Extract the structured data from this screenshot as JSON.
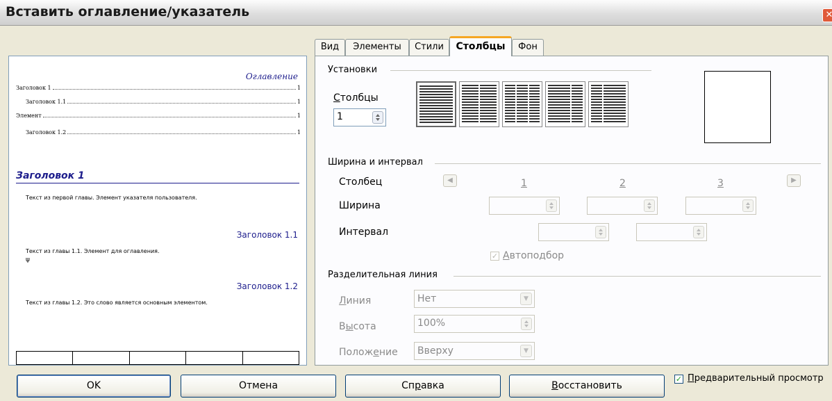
{
  "window": {
    "title": "Вставить оглавление/указатель",
    "close_symbol": "✕"
  },
  "tabs": [
    {
      "label": "Вид"
    },
    {
      "label": "Элементы"
    },
    {
      "label": "Стили"
    },
    {
      "label": "Столбцы",
      "active": true
    },
    {
      "label": "Фон"
    }
  ],
  "preview": {
    "toc_title": "Оглавление",
    "toc_entries": [
      {
        "text": "Заголовок 1",
        "page": "1"
      },
      {
        "text": "Заголовок 1.1",
        "page": "1"
      },
      {
        "text": "Элемент",
        "page": "1"
      },
      {
        "text": "Заголовок 1.2",
        "page": "1"
      }
    ],
    "heading1": "Заголовок 1",
    "text1": "Текст из первой главы. Элемент указателя пользователя.",
    "heading11": "Заголовок 1.1",
    "text11": "Текст из главы 1.1. Элемент для оглавления.",
    "marker": "ψ",
    "heading12": "Заголовок 1.2",
    "text12": "Текст из главы 1.2. Это слово является основным элементом."
  },
  "settings": {
    "section_label": "Установки",
    "columns_label_mnemonic": "С",
    "columns_label_rest": "толбцы",
    "columns_value": "1"
  },
  "width_spacing": {
    "section_label": "Ширина и интервал",
    "column_label": "Столбец",
    "width_label": "Ширина",
    "spacing_label": "Интервал",
    "col_numbers": [
      "1",
      "2",
      "3"
    ],
    "prev_arrow": "◀",
    "next_arrow": "▶",
    "autofit_mnemonic": "А",
    "autofit_rest": "втоподбор",
    "autofit_checked": true,
    "check_mark": "✓"
  },
  "separator": {
    "section_label": "Разделительная линия",
    "line_label_mnemonic": "Л",
    "line_label_rest": "иния",
    "line_value": "Нет",
    "height_label_pre": "В",
    "height_label_mnemonic": "ы",
    "height_label_rest": "сота",
    "height_value": "100%",
    "position_label_pre": "Полож",
    "position_label_mnemonic": "е",
    "position_label_rest": "ние",
    "position_value": "Вверху",
    "dropdown_arrow": "▼"
  },
  "buttons": {
    "ok": "OK",
    "cancel": "Отмена",
    "help_pre": "Сп",
    "help_mnemonic": "р",
    "help_rest": "авка",
    "reset_mnemonic": "В",
    "reset_rest": "осстановить",
    "preview_mnemonic": "П",
    "preview_rest": "редварительный просмотр",
    "preview_checked": true
  }
}
